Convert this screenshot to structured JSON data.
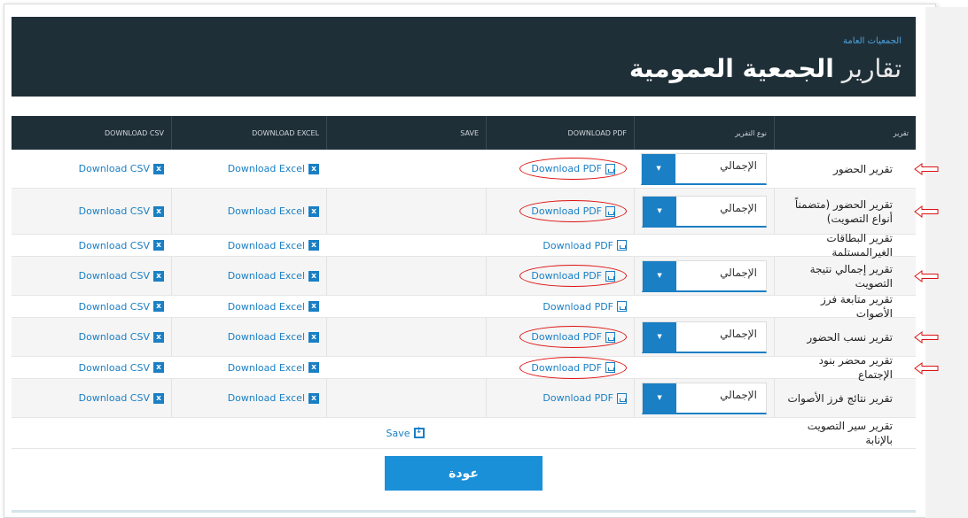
{
  "header": {
    "breadcrumb": "الجمعيات العامة",
    "title_light": "تقارير",
    "title_bold": "الجمعية العمومية"
  },
  "table": {
    "columns": [
      "تقرير",
      "نوع التقرير",
      "DOWNLOAD PDF",
      "SAVE",
      "DOWNLOAD EXCEL",
      "DOWNLOAD CSV"
    ],
    "labels": {
      "pdf": "Download PDF",
      "excel": "Download Excel",
      "csv": "Download CSV",
      "save": "Save"
    },
    "rows": [
      {
        "name": "تقرير الحضور",
        "type": "الإجمالي",
        "pdf": true,
        "excel": true,
        "csv": true,
        "save": false,
        "marked": true
      },
      {
        "name": "تقرير الحضور (متضمناً أنواع التصويت)",
        "type": "الإجمالي",
        "pdf": true,
        "excel": true,
        "csv": true,
        "save": false,
        "marked": true
      },
      {
        "name": "تقرير البطاقات الغيرالمستلمة",
        "type": "",
        "pdf": true,
        "excel": true,
        "csv": true,
        "save": false,
        "marked": false
      },
      {
        "name": "تقرير إجمالي نتيجة التصويت",
        "type": "الإجمالي",
        "pdf": true,
        "excel": true,
        "csv": true,
        "save": false,
        "marked": true
      },
      {
        "name": "تقرير متابعة فرز الأصوات",
        "type": "",
        "pdf": true,
        "excel": true,
        "csv": true,
        "save": false,
        "marked": false
      },
      {
        "name": "تقرير نسب الحضور",
        "type": "الإجمالي",
        "pdf": true,
        "excel": true,
        "csv": true,
        "save": false,
        "marked": true
      },
      {
        "name": "تقرير محضر بنود الإجتماع",
        "type": "",
        "pdf": true,
        "excel": true,
        "csv": true,
        "save": false,
        "marked": true
      },
      {
        "name": "تقرير نتائج فرز الأصوات",
        "type": "الإجمالي",
        "pdf": true,
        "excel": true,
        "csv": true,
        "save": false,
        "marked": false
      },
      {
        "name": "تقرير سير التصويت بالإنابة",
        "type": "",
        "pdf": false,
        "excel": false,
        "csv": false,
        "save": true,
        "marked": false
      }
    ]
  },
  "back_button": "عودة",
  "colors": {
    "header_bg": "#1f2f38",
    "accent": "#1a7fc4",
    "marker": "#dd1111"
  }
}
